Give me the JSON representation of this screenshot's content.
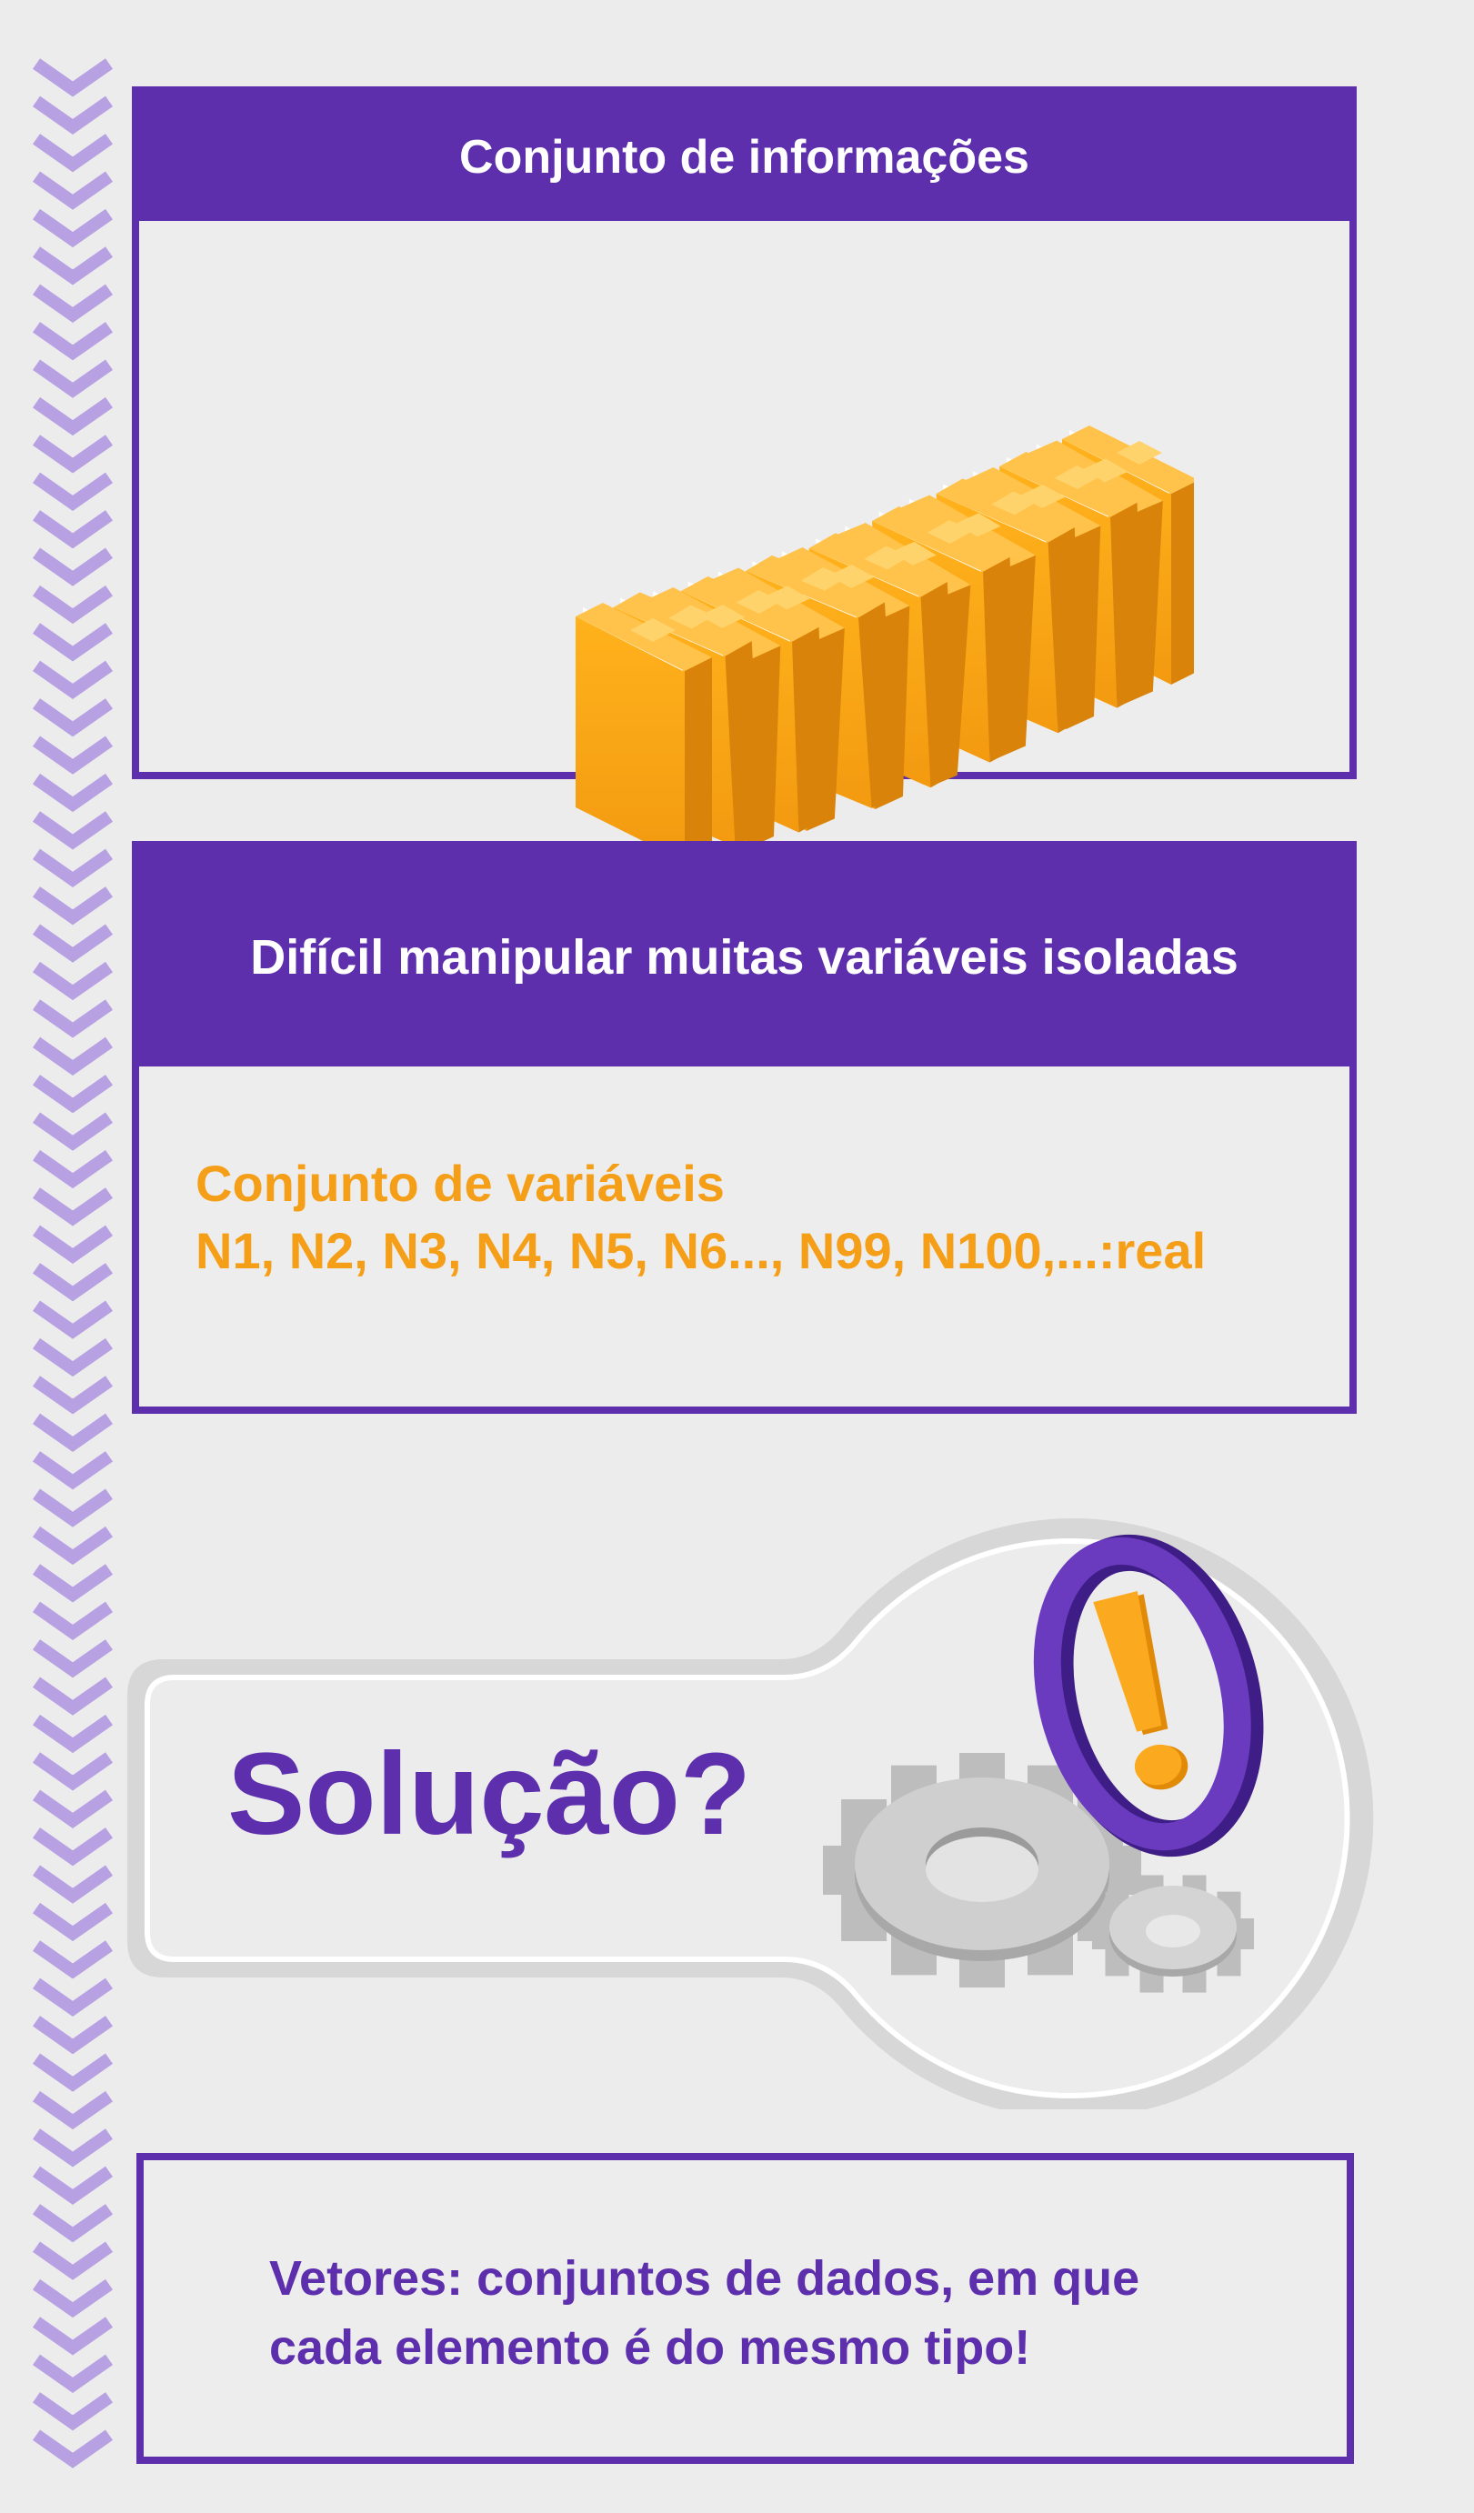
{
  "card1": {
    "title": "Conjunto de informações",
    "illustration": "folders-icon"
  },
  "card2": {
    "title": "Difícil manipular muitas variáveis isoladas",
    "line1": "Conjunto de variáveis",
    "line2": "N1, N2, N3, N4, N5, N6..., N99, N100,...:real"
  },
  "solution": {
    "label": "Solução?",
    "icons": [
      "gears-icon",
      "exclamation-icon"
    ]
  },
  "card4": {
    "line1": "Vetores: conjuntos de dados, em que",
    "line2": "cada elemento é do mesmo tipo!"
  },
  "colors": {
    "purple": "#5d2fad",
    "orange": "#f59e18",
    "chevron": "#b7a1e3",
    "background": "#ececec"
  }
}
